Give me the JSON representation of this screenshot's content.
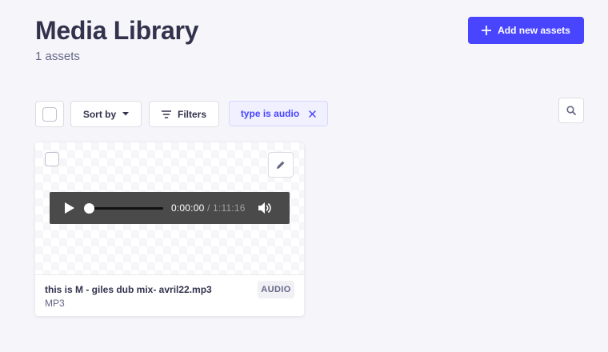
{
  "header": {
    "title": "Media Library",
    "asset_count": "1 assets",
    "add_button_label": "Add new assets"
  },
  "toolbar": {
    "sort_label": "Sort by",
    "filters_label": "Filters",
    "active_filter": "type is audio"
  },
  "asset": {
    "name": "this is M - giles dub mix- avril22.mp3",
    "extension": "MP3",
    "type_badge": "AUDIO",
    "player": {
      "current_time": "0:00:00",
      "separator": " / ",
      "duration": "1:11:16",
      "progress": 0
    }
  },
  "colors": {
    "primary": "#4945ff",
    "background": "#f5f5fa",
    "text": "#32324d",
    "muted": "#666687"
  },
  "icons": [
    "plus-icon",
    "chevron-down-icon",
    "filter-icon",
    "close-icon",
    "search-icon",
    "pencil-icon",
    "play-icon",
    "volume-icon"
  ]
}
